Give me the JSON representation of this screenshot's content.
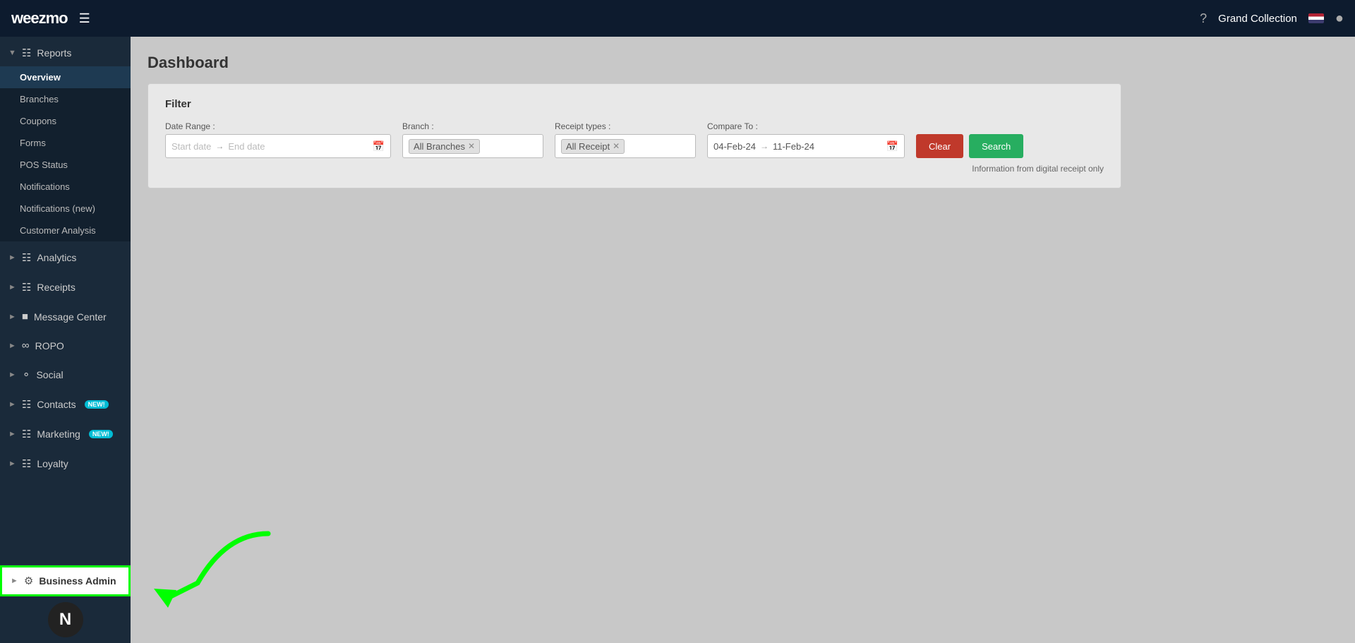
{
  "app": {
    "logo": "weezmo",
    "brand_name": "Grand Collection"
  },
  "topnav": {
    "help_tooltip": "Help",
    "brand_label": "Grand Collection"
  },
  "sidebar": {
    "reports_label": "Reports",
    "reports_children": [
      {
        "label": "Overview",
        "active": true
      },
      {
        "label": "Branches",
        "active": false
      },
      {
        "label": "Coupons",
        "active": false
      },
      {
        "label": "Forms",
        "active": false
      },
      {
        "label": "POS Status",
        "active": false
      },
      {
        "label": "Notifications",
        "active": false
      },
      {
        "label": "Notifications (new)",
        "active": false
      },
      {
        "label": "Customer Analysis",
        "active": false
      }
    ],
    "analytics_label": "Analytics",
    "receipts_label": "Receipts",
    "message_center_label": "Message Center",
    "ropo_label": "ROPO",
    "social_label": "Social",
    "contacts_label": "Contacts",
    "contacts_badge": "NEW!",
    "marketing_label": "Marketing",
    "marketing_badge": "NEW!",
    "loyalty_label": "Loyalty",
    "business_admin_label": "Business Admin"
  },
  "main": {
    "page_title": "Dashboard",
    "filter": {
      "section_title": "Filter",
      "date_range_label": "Date Range :",
      "date_range_start": "Start date",
      "date_range_arrow": "→",
      "date_range_end": "End date",
      "branch_label": "Branch :",
      "branch_value": "All Branches",
      "receipt_types_label": "Receipt types :",
      "receipt_types_value": "All Receipt",
      "compare_to_label": "Compare To :",
      "compare_from": "04-Feb-24",
      "compare_arrow": "→",
      "compare_to": "11-Feb-24",
      "clear_button": "Clear",
      "search_button": "Search",
      "info_text": "Information from digital receipt only"
    }
  }
}
